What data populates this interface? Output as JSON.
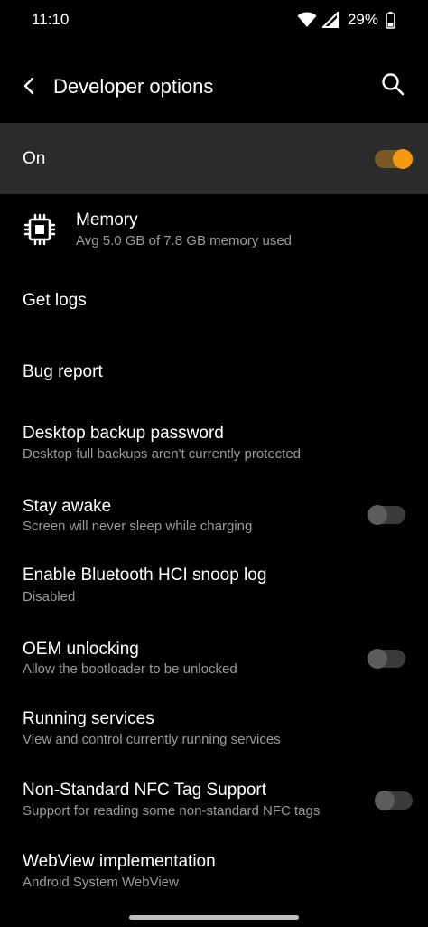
{
  "status_bar": {
    "time": "11:10",
    "battery": "29%"
  },
  "app_bar": {
    "title": "Developer options"
  },
  "master_switch": {
    "label": "On",
    "state": true,
    "accent_color": "#f39a12"
  },
  "items": [
    {
      "title": "Memory",
      "subtitle": "Avg 5.0 GB of 7.8 GB memory used",
      "icon": "memory-chip-icon"
    },
    {
      "title": "Get logs"
    },
    {
      "title": "Bug report"
    },
    {
      "title": "Desktop backup password",
      "subtitle": "Desktop full backups aren't currently protected"
    },
    {
      "title": "Stay awake",
      "subtitle": "Screen will never sleep while charging",
      "toggle": false
    },
    {
      "title": "Enable Bluetooth HCI snoop log",
      "subtitle": "Disabled"
    },
    {
      "title": "OEM unlocking",
      "subtitle": "Allow the bootloader to be unlocked",
      "toggle": false
    },
    {
      "title": "Running services",
      "subtitle": "View and control currently running services"
    },
    {
      "title": "Non-Standard NFC Tag Support",
      "subtitle": "Support for reading some non-standard NFC tags",
      "toggle": false
    },
    {
      "title": "WebView implementation",
      "subtitle": "Android System WebView"
    }
  ]
}
